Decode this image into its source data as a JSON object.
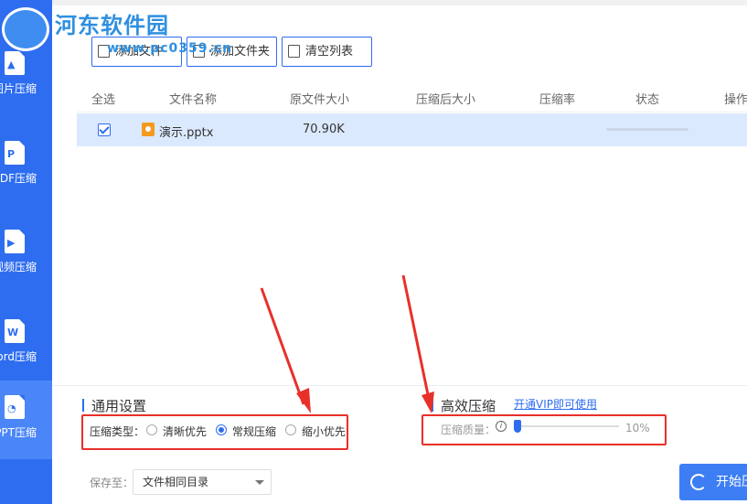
{
  "brand": {
    "logo_text": "河东软件园",
    "watermark": "www.pc0359.cn"
  },
  "sidebar": {
    "items": [
      {
        "label": "图片压缩",
        "icon": "image-file-icon",
        "glyph": "▲"
      },
      {
        "label": "PDF压缩",
        "icon": "pdf-file-icon",
        "glyph": "P"
      },
      {
        "label": "视频压缩",
        "icon": "video-file-icon",
        "glyph": "▶"
      },
      {
        "label": "Word压缩",
        "icon": "word-file-icon",
        "glyph": "W"
      },
      {
        "label": "PPT压缩",
        "icon": "ppt-file-icon",
        "glyph": "◔"
      }
    ],
    "active_index": 4
  },
  "toolbar": {
    "add_file_label": "添加文件",
    "add_folder_label": "添加文件夹",
    "clear_list_label": "清空列表"
  },
  "table": {
    "headers": [
      "全选",
      "文件名称",
      "原文件大小",
      "压缩后大小",
      "压缩率",
      "状态",
      "操作"
    ],
    "rows": [
      {
        "checked": true,
        "name": "演示.pptx",
        "original_size": "70.90K",
        "compressed_size": "",
        "ratio": "",
        "status": ""
      }
    ]
  },
  "general_settings": {
    "title": "通用设置",
    "type_label": "压缩类型：",
    "options": [
      "清晰优先",
      "常规压缩",
      "缩小优先"
    ],
    "selected": "常规压缩"
  },
  "efficient_compress": {
    "title": "高效压缩",
    "vip_link": "开通VIP即可使用",
    "quality_label": "压缩质量：",
    "quality_value": "10%",
    "quality_fraction": 0.1
  },
  "footer": {
    "save_label": "保存至：",
    "save_option": "文件相同目录",
    "start_label": "开始压缩"
  },
  "colors": {
    "sidebar": "#2e6df0",
    "accent": "#2e6df0",
    "annotation": "#e8302a",
    "selected_row": "#dbe9ff"
  }
}
